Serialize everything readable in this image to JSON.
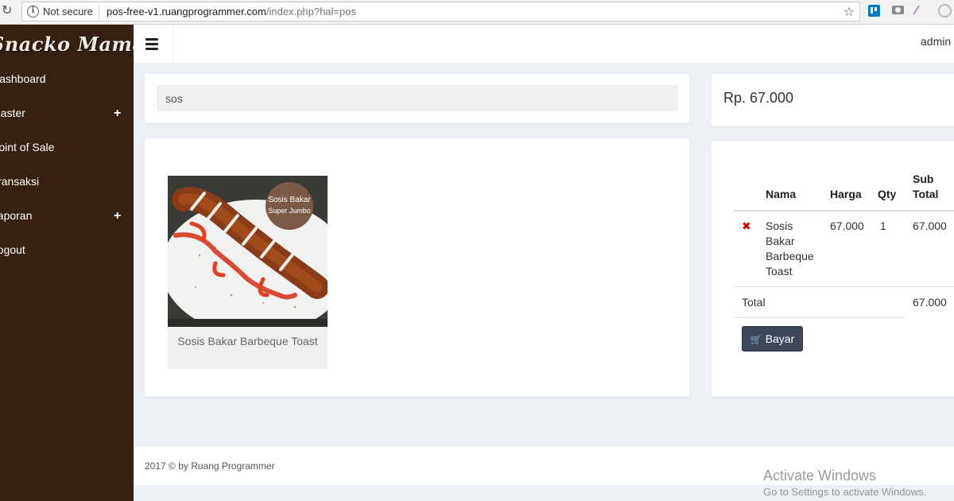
{
  "browser": {
    "security_label": "Not secure",
    "url_host": "pos-free-v1.ruangprogrammer.com",
    "url_path": "/index.php?hal=pos"
  },
  "sidebar": {
    "brand": "Snacko Mama",
    "items": [
      {
        "label": "Dashboard",
        "expandable": false
      },
      {
        "label": "Master",
        "expandable": true
      },
      {
        "label": "Point of Sale",
        "expandable": false
      },
      {
        "label": "Transaksi",
        "expandable": false
      },
      {
        "label": "Laporan",
        "expandable": true
      },
      {
        "label": "Logout",
        "expandable": false
      }
    ]
  },
  "header": {
    "username": "admin"
  },
  "search": {
    "value": "sos"
  },
  "summary": {
    "total_display": "Rp. 67.000"
  },
  "products": [
    {
      "name": "Sosis Bakar Barbeque Toast",
      "badge_line1": "Sosis Bakar",
      "badge_line2": "Super Jumbo"
    }
  ],
  "cart": {
    "headers": {
      "nama": "Nama",
      "harga": "Harga",
      "qty": "Qty",
      "sub_line1": "Sub",
      "sub_line2": "Total"
    },
    "rows": [
      {
        "name_lines": [
          "Sosis",
          "Bakar",
          "Barbeque",
          "Toast"
        ],
        "harga": "67.000",
        "qty": "1",
        "subtotal": "67.000"
      }
    ],
    "total_label": "Total",
    "total_value": "67.000",
    "pay_label": "Bayar"
  },
  "footer": {
    "text": "2017 © by Ruang Programmer"
  },
  "watermark": {
    "line1": "Activate Windows",
    "line2": "Go to Settings to activate Windows."
  },
  "colors": {
    "sidebar_bg": "#37200f",
    "content_bg": "#ecf0f5",
    "pay_button": "#3d4758",
    "remove_icon": "#dd0000"
  },
  "icons": [
    "reload-icon",
    "info-icon",
    "star-icon",
    "hamburger-icon",
    "plus-icon",
    "remove-icon",
    "cart-icon"
  ]
}
